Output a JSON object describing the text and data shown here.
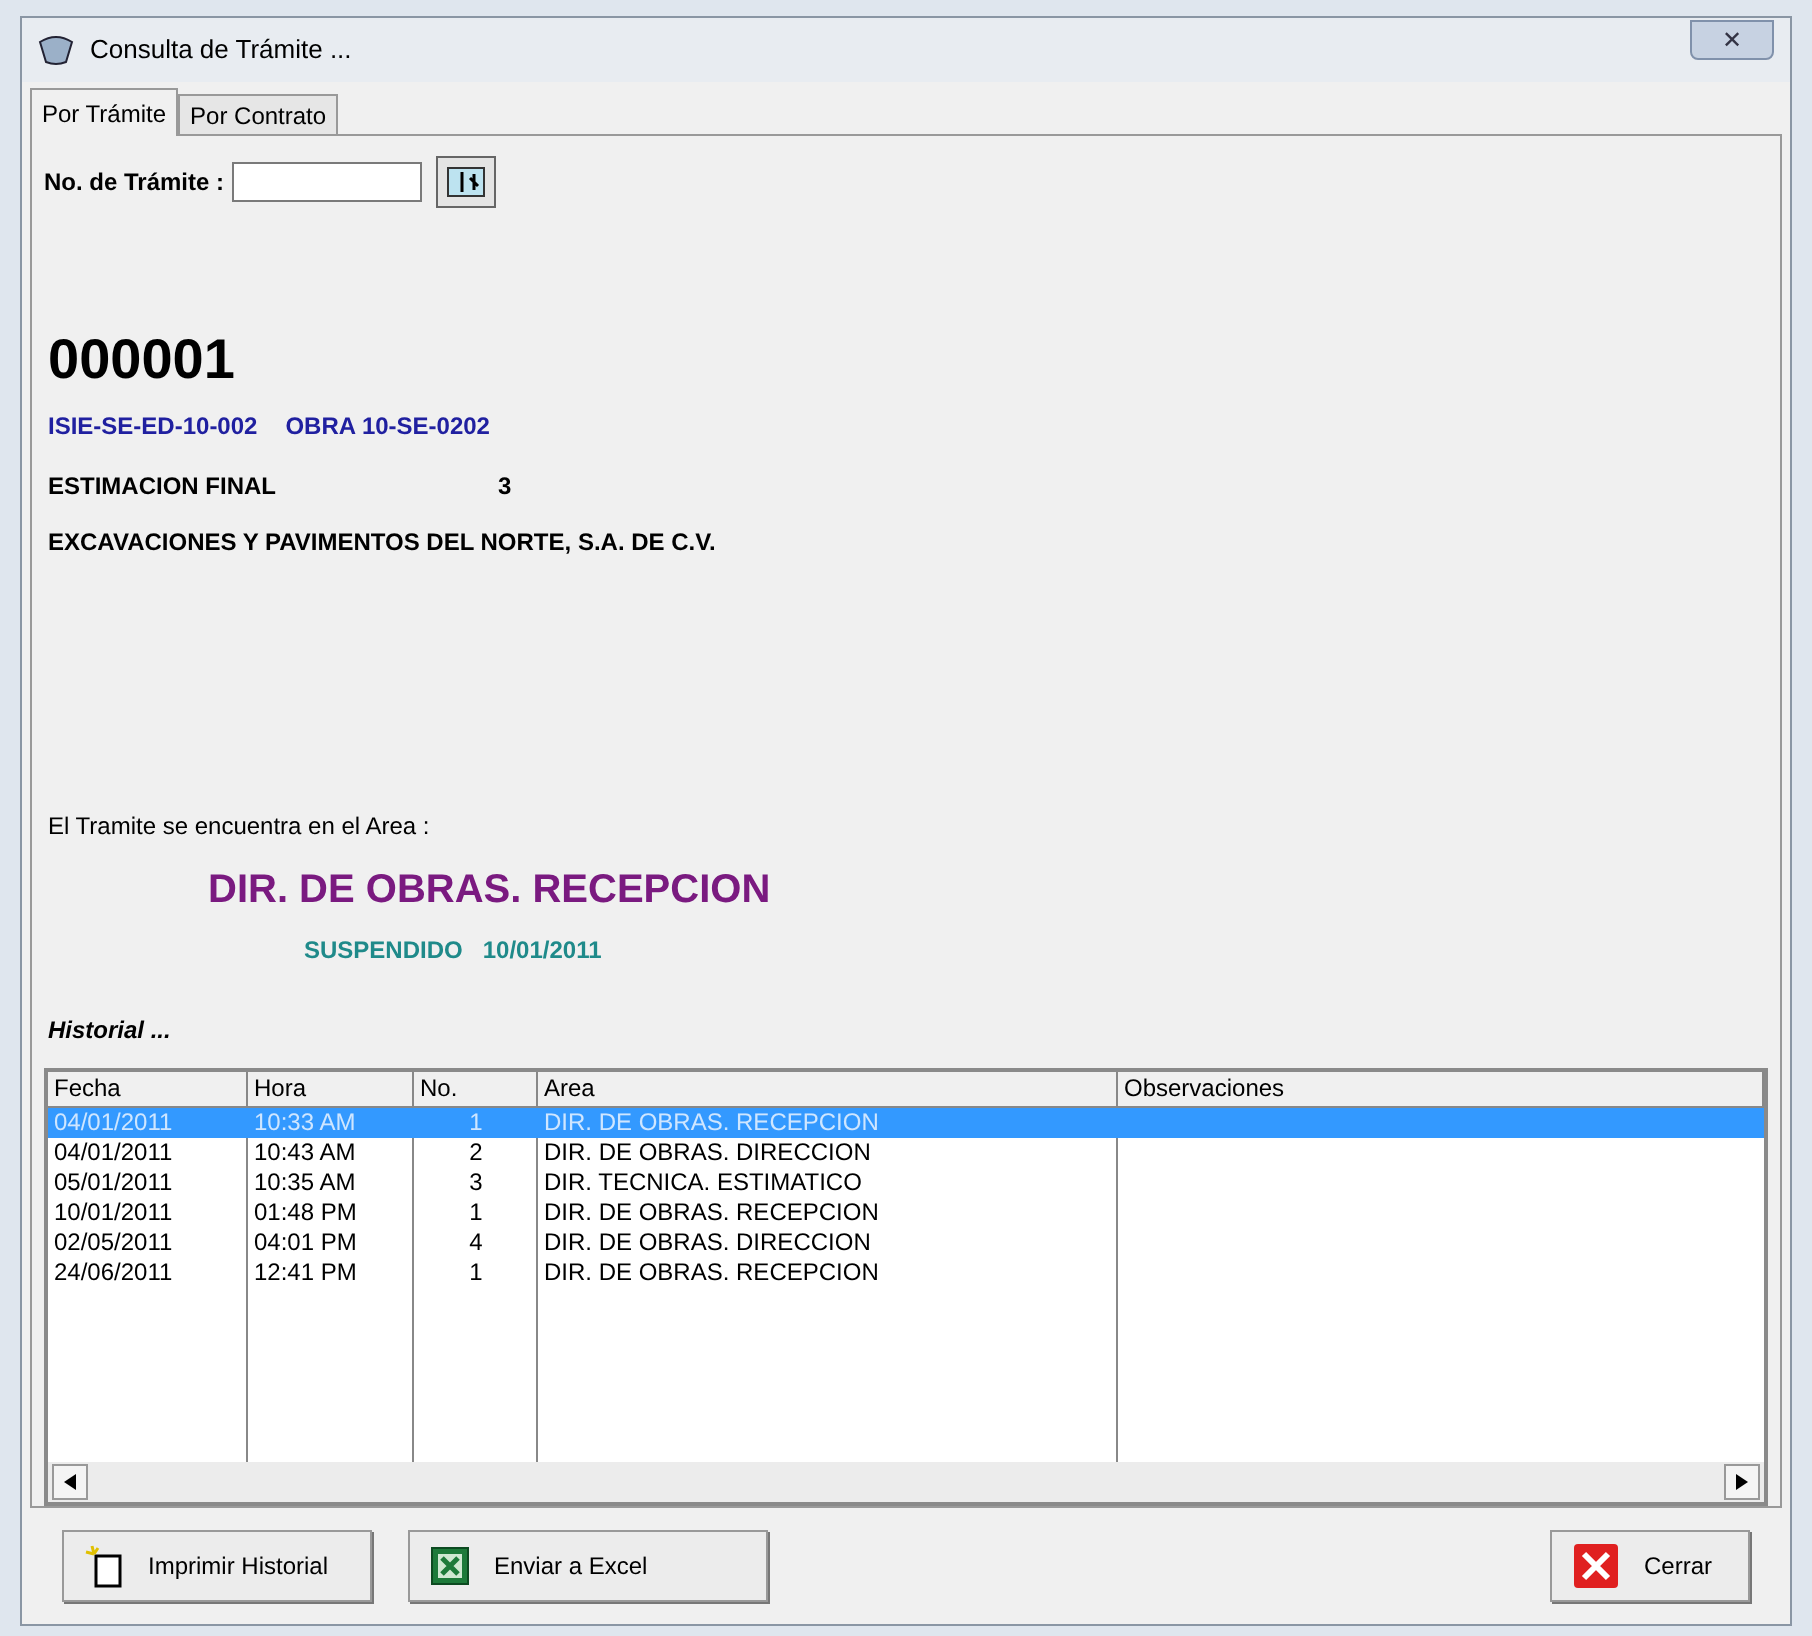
{
  "window": {
    "title": "Consulta de Trámite ...",
    "close": "✕"
  },
  "tabs": [
    {
      "label": "Por Trámite",
      "selected": true
    },
    {
      "label": "Por Contrato",
      "selected": false
    }
  ],
  "search": {
    "label": "No. de Trámite :"
  },
  "tramite": {
    "number": "000001",
    "code": "ISIE-SE-ED-10-002",
    "obra": "OBRA 10-SE-0202",
    "concept": "ESTIMACION FINAL",
    "concept_no": "3",
    "company": "EXCAVACIONES Y PAVIMENTOS DEL NORTE, S.A. DE C.V."
  },
  "location": {
    "label": "El Tramite se encuentra en el Area :",
    "area": "DIR. DE OBRAS. RECEPCION",
    "status": "SUSPENDIDO",
    "date": "10/01/2011"
  },
  "history": {
    "title": "Historial ...",
    "columns": [
      "Fecha",
      "Hora",
      "No.",
      "Area",
      "Observaciones"
    ],
    "rows": [
      {
        "cells": [
          "04/01/2011",
          "10:33 AM",
          "1",
          "DIR. DE OBRAS. RECEPCION"
        ],
        "selected": true
      },
      {
        "cells": [
          "04/01/2011",
          "10:43 AM",
          "2",
          "DIR. DE OBRAS. DIRECCION"
        ],
        "selected": false
      },
      {
        "cells": [
          "05/01/2011",
          "10:35 AM",
          "3",
          "DIR. TECNICA. ESTIMATICO"
        ],
        "selected": false
      },
      {
        "cells": [
          "10/01/2011",
          "01:48 PM",
          "1",
          "DIR. DE OBRAS. RECEPCION"
        ],
        "selected": false
      },
      {
        "cells": [
          "02/05/2011",
          "04:01 PM",
          "4",
          "DIR. DE OBRAS. DIRECCION"
        ],
        "selected": false
      },
      {
        "cells": [
          "24/06/2011",
          "12:41 PM",
          "1",
          "DIR. DE OBRAS. RECEPCION"
        ],
        "selected": false
      }
    ]
  },
  "buttons": [
    {
      "kind": "print",
      "label": "Imprimir Historial"
    },
    {
      "kind": "excel",
      "label": "Enviar a Excel"
    },
    {
      "kind": "close",
      "label": "Cerrar"
    }
  ]
}
